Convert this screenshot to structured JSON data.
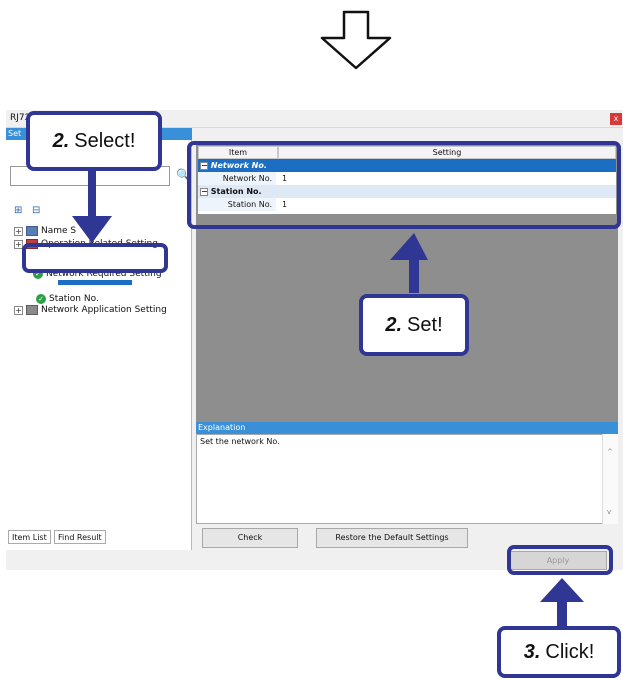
{
  "window": {
    "title": "RJ72",
    "close_label": "x",
    "left_header": "Set",
    "right_header": ""
  },
  "callouts": {
    "select_num": "2.",
    "select_label": "Select!",
    "set_num": "2.",
    "set_label": "Set!",
    "click_num": "3.",
    "click_label": "Click!"
  },
  "tree": {
    "items": [
      {
        "label": "Name S"
      },
      {
        "label": "Operation Related Setting"
      },
      {
        "label": "Network Required Setting"
      },
      {
        "label": "Station No."
      },
      {
        "label": "Network Application Setting"
      }
    ],
    "selected_sub": "Network No."
  },
  "left_tabs": [
    "Item List",
    "Find Result"
  ],
  "grid": {
    "headers": [
      "Item",
      "Setting"
    ],
    "rows": [
      {
        "item": "Network No.",
        "value": ""
      },
      {
        "item": "Network No.",
        "value": "1"
      },
      {
        "item": "Station No.",
        "value": ""
      },
      {
        "item": "Station No.",
        "value": "1"
      }
    ]
  },
  "explanation": {
    "title": "Explanation",
    "text": "Set the network No."
  },
  "buttons": {
    "check": "Check",
    "restore": "Restore the Default Settings",
    "apply": "Apply"
  },
  "colors": {
    "callout_border": "#2f3693",
    "header_blue": "#3a90d8",
    "selected_row": "#1b6ec2"
  }
}
